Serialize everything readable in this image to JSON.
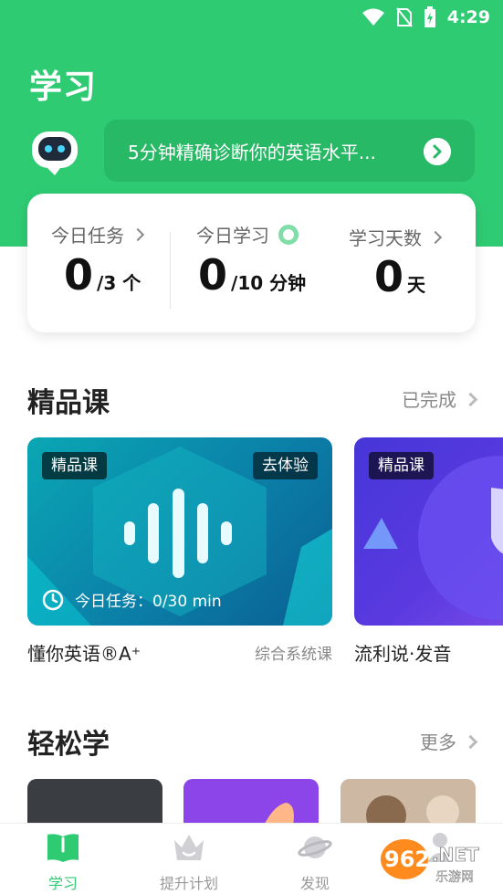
{
  "status_bar": {
    "time": "4:29"
  },
  "header": {
    "title": "学习",
    "assessment_text": "5分钟精确诊断你的英语水平..."
  },
  "stats": [
    {
      "label": "今日任务",
      "value": "0",
      "unit": "/3 个"
    },
    {
      "label": "今日学习",
      "value": "0",
      "unit": "/10 分钟"
    },
    {
      "label": "学习天数",
      "value": "0",
      "unit": "天"
    }
  ],
  "premium_section": {
    "title": "精品课",
    "link": "已完成",
    "courses": [
      {
        "tag": "精品课",
        "action": "去体验",
        "task": "今日任务：0/30 min",
        "name": "懂你英语®A⁺",
        "subtitle": "综合系统课"
      },
      {
        "tag": "精品课",
        "name": "流利说·发音"
      }
    ]
  },
  "easy_section": {
    "title": "轻松学",
    "link": "更多"
  },
  "tabbar": [
    {
      "label": "学习",
      "icon": "book-icon",
      "active": true
    },
    {
      "label": "提升计划",
      "icon": "crown-icon",
      "active": false
    },
    {
      "label": "发现",
      "icon": "planet-icon",
      "active": false
    },
    {
      "label": "",
      "icon": "profile-icon",
      "active": false
    }
  ],
  "watermark": {
    "text": "962.NET",
    "subtext": "乐游网"
  },
  "colors": {
    "brand": "#2fcb73",
    "brand_dark": "#27b965",
    "text": "#222222",
    "muted": "#888888"
  }
}
